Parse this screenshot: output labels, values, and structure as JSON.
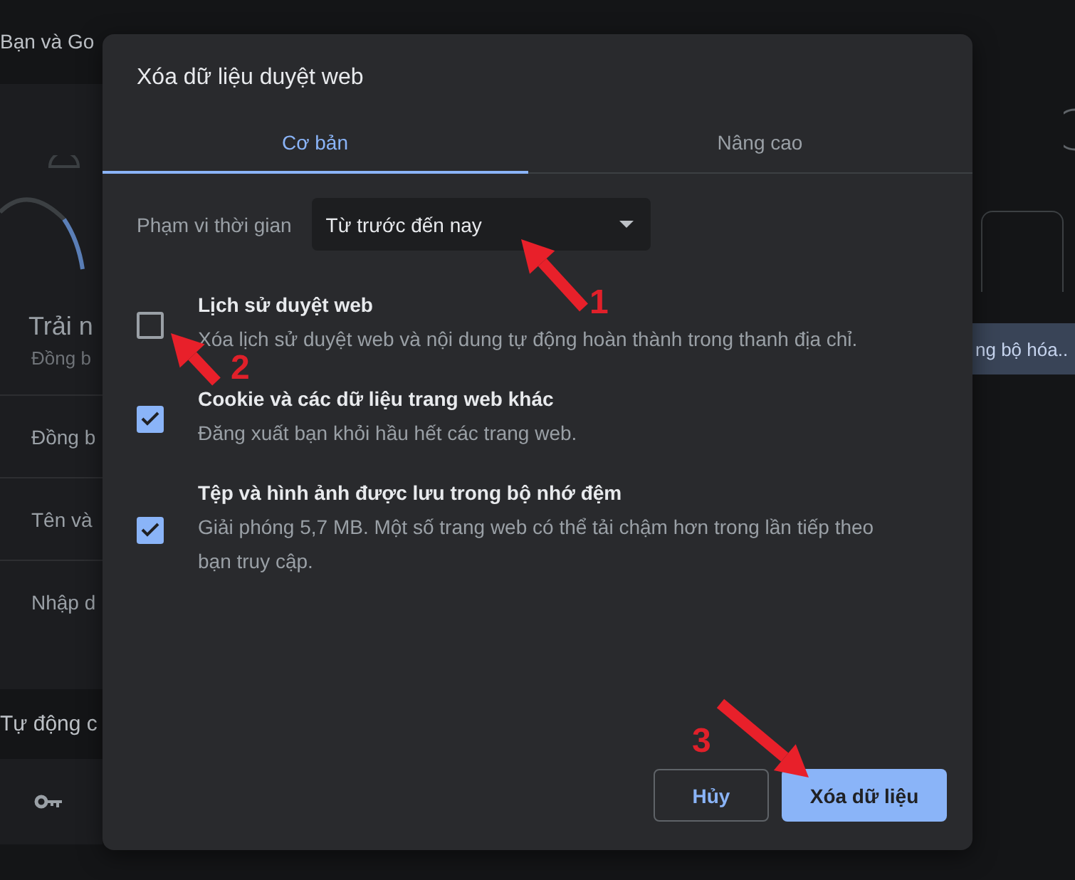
{
  "page": {
    "header": "Bạn và Go",
    "profile_title": "Trải n",
    "profile_subtitle": "Đồng b",
    "rows": [
      "Đồng b",
      "Tên và",
      "Nhập d"
    ],
    "section_title": "Tự động c",
    "sync_button": "ng bộ hóa.."
  },
  "dialog": {
    "title": "Xóa dữ liệu duyệt web",
    "tabs": [
      {
        "label": "Cơ bản",
        "selected": true
      },
      {
        "label": "Nâng cao",
        "selected": false
      }
    ],
    "time_range": {
      "label": "Phạm vi thời gian",
      "value": "Từ trước đến nay"
    },
    "options": [
      {
        "title": "Lịch sử duyệt web",
        "description": "Xóa lịch sử duyệt web và nội dung tự động hoàn thành trong thanh địa chỉ.",
        "checked": false
      },
      {
        "title": "Cookie và các dữ liệu trang web khác",
        "description": "Đăng xuất bạn khỏi hầu hết các trang web.",
        "checked": true
      },
      {
        "title": "Tệp và hình ảnh được lưu trong bộ nhớ đệm",
        "description": "Giải phóng 5,7 MB. Một số trang web có thể tải chậm hơn trong lần tiếp theo bạn truy cập.",
        "checked": true
      }
    ],
    "buttons": [
      {
        "label": "Hủy",
        "kind": "secondary"
      },
      {
        "label": "Xóa dữ liệu",
        "kind": "primary"
      }
    ]
  },
  "annotations": [
    {
      "number": "1"
    },
    {
      "number": "2"
    },
    {
      "number": "3"
    }
  ]
}
